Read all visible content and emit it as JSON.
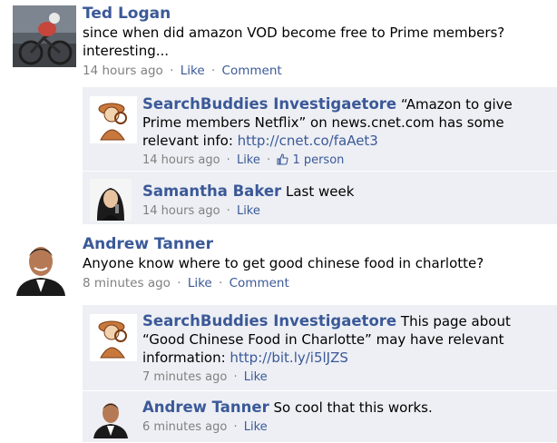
{
  "posts": [
    {
      "author": "Ted Logan",
      "message_line1": "since when did amazon VOD become free to Prime members?",
      "message_line2": "interesting...",
      "time": "14 hours ago",
      "like": "Like",
      "comment": "Comment",
      "comments": [
        {
          "author": "SearchBuddies Investigaetore",
          "line1": "“Amazon to give",
          "line2": "Prime members Netflix” on news.cnet.com has some",
          "line3_prefix": "relevant info: ",
          "url": "http://cnet.co/faAet3",
          "time": "14 hours ago",
          "like": "Like",
          "likes_count": "1 person"
        },
        {
          "author": "Samantha Baker",
          "text": "Last week",
          "time": "14 hours ago",
          "like": "Like"
        }
      ]
    },
    {
      "author": "Andrew Tanner",
      "message_line1": "Anyone know where to get good chinese food in charlotte?",
      "time": "8 minutes ago",
      "like": "Like",
      "comment": "Comment",
      "comments": [
        {
          "author": "SearchBuddies Investigaetore",
          "line1": "This page about",
          "line2": "“Good Chinese Food in Charlotte” may have relevant",
          "line3_prefix": "information: ",
          "url": "http://bit.ly/i5lJZS",
          "time": "7 minutes ago",
          "like": "Like"
        },
        {
          "author": "Andrew Tanner",
          "text": "So cool that this works.",
          "time": "6 minutes ago",
          "like": "Like"
        }
      ]
    }
  ],
  "separator": "·",
  "colors": {
    "link": "#3b5998",
    "comment_bg": "#edeff4",
    "meta": "#808080"
  },
  "icons": {
    "thumbs_up": "thumbs-up-icon"
  }
}
